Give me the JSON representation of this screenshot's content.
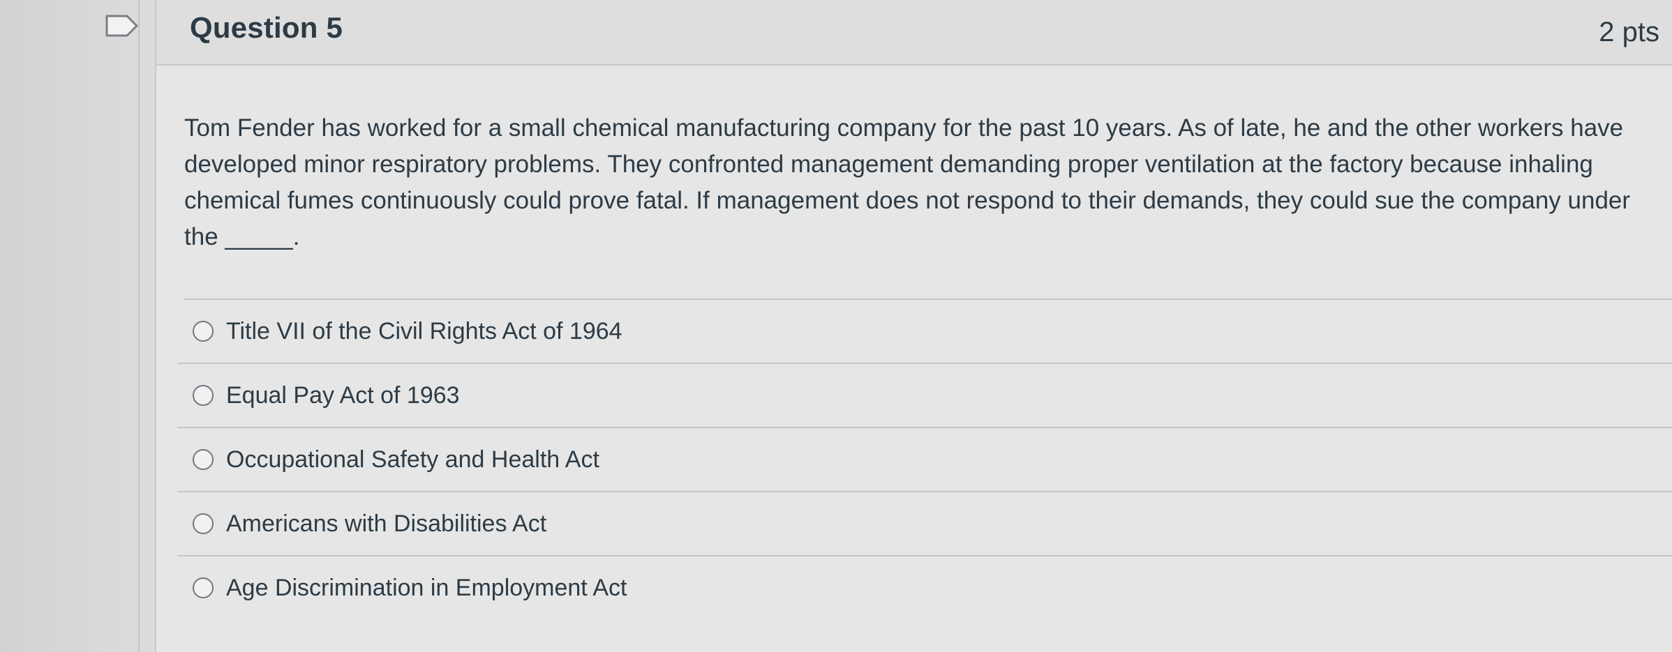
{
  "question": {
    "title": "Question 5",
    "points": "2 pts",
    "text": "Tom Fender has worked for a small chemical manufacturing company for the past 10 years. As of late, he and the other workers have developed minor respiratory problems. They confronted management demanding proper ventilation at the factory because inhaling chemical fumes continuously could prove fatal. If management does not respond to their demands, they could sue the company under the _____."
  },
  "answers": [
    {
      "label": "Title VII of the Civil Rights Act of 1964",
      "selected": false
    },
    {
      "label": "Equal Pay Act of 1963",
      "selected": false
    },
    {
      "label": "Occupational Safety and Health Act",
      "selected": false
    },
    {
      "label": "Americans with Disabilities Act",
      "selected": false
    },
    {
      "label": "Age Discrimination in Employment Act",
      "selected": false
    }
  ],
  "icons": {
    "flag": "flag-icon",
    "radio": "radio-button-icon"
  },
  "colors": {
    "text": "#2d3b45",
    "background": "#e6e6e6",
    "divider": "#c6c6c6"
  }
}
